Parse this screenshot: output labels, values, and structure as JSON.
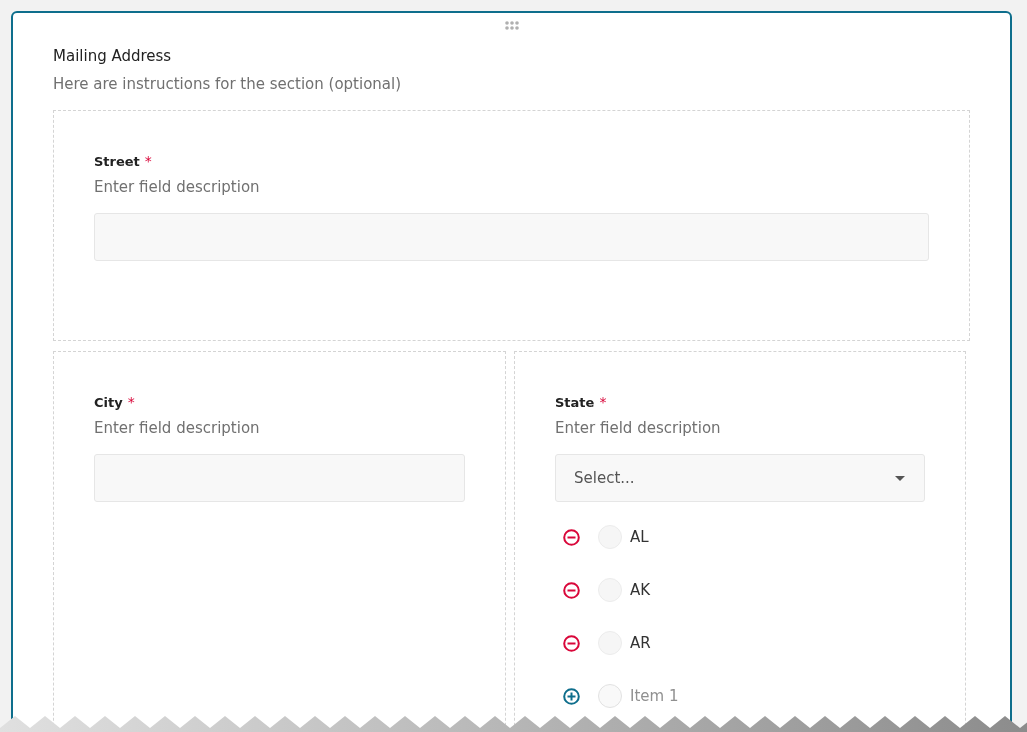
{
  "section": {
    "title": "Mailing Address",
    "instructions": "Here are instructions for the section (optional)"
  },
  "fields": [
    {
      "kind": "text",
      "label": "Street",
      "required_mark": "*",
      "description": "Enter field description"
    },
    {
      "kind": "text",
      "label": "City",
      "required_mark": "*",
      "description": "Enter field description"
    },
    {
      "kind": "select",
      "label": "State",
      "required_mark": "*",
      "description": "Enter field description",
      "placeholder": "Select...",
      "options": [
        {
          "kind": "remove",
          "label": "AL",
          "selected": false
        },
        {
          "kind": "remove",
          "label": "AK",
          "selected": false
        },
        {
          "kind": "remove",
          "label": "AR",
          "selected": false
        },
        {
          "kind": "add",
          "label": "Item 1",
          "selected": false
        }
      ]
    }
  ]
}
